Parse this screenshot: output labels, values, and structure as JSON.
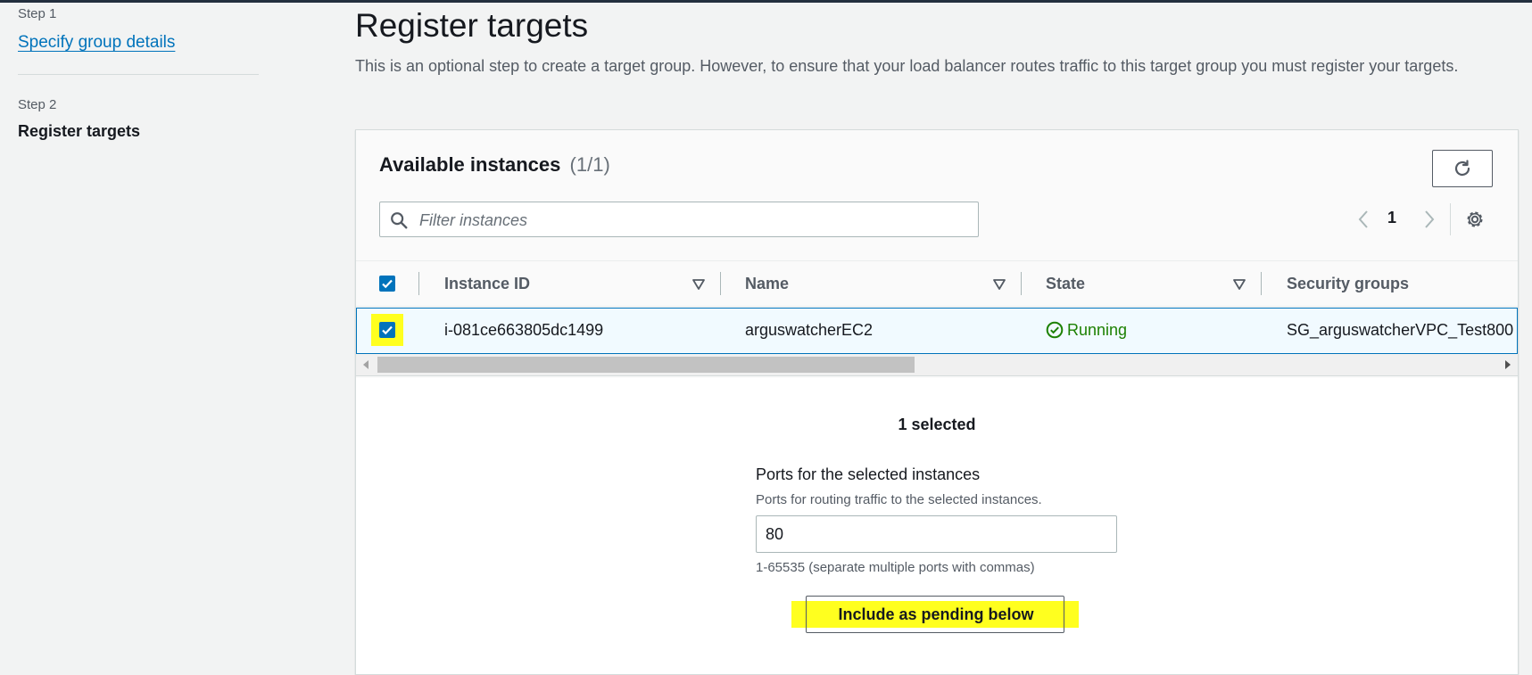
{
  "sidebar": {
    "step1_label": "Step 1",
    "step1_link": "Specify group details",
    "step2_label": "Step 2",
    "step2_current": "Register targets"
  },
  "page": {
    "title": "Register targets",
    "description": "This is an optional step to create a target group. However, to ensure that your load balancer routes traffic to this target group you must register your targets."
  },
  "panel": {
    "title": "Available instances",
    "count": "(1/1)",
    "search_placeholder": "Filter instances",
    "page_number": "1"
  },
  "table": {
    "columns": [
      "Instance ID",
      "Name",
      "State",
      "Security groups"
    ],
    "rows": [
      {
        "instance_id": "i-081ce663805dc1499",
        "name": "arguswatcherEC2",
        "state": "Running",
        "security_groups": "SG_arguswatcherVPC_Test800",
        "selected": true
      }
    ]
  },
  "selection": {
    "count_text": "1 selected",
    "ports_label": "Ports for the selected instances",
    "ports_description": "Ports for routing traffic to the selected instances.",
    "ports_value": "80",
    "ports_hint": "1-65535 (separate multiple ports with commas)",
    "include_button": "Include as pending below"
  },
  "colors": {
    "link": "#0073bb",
    "running": "#1d8102",
    "highlight": "#ffff1f"
  }
}
